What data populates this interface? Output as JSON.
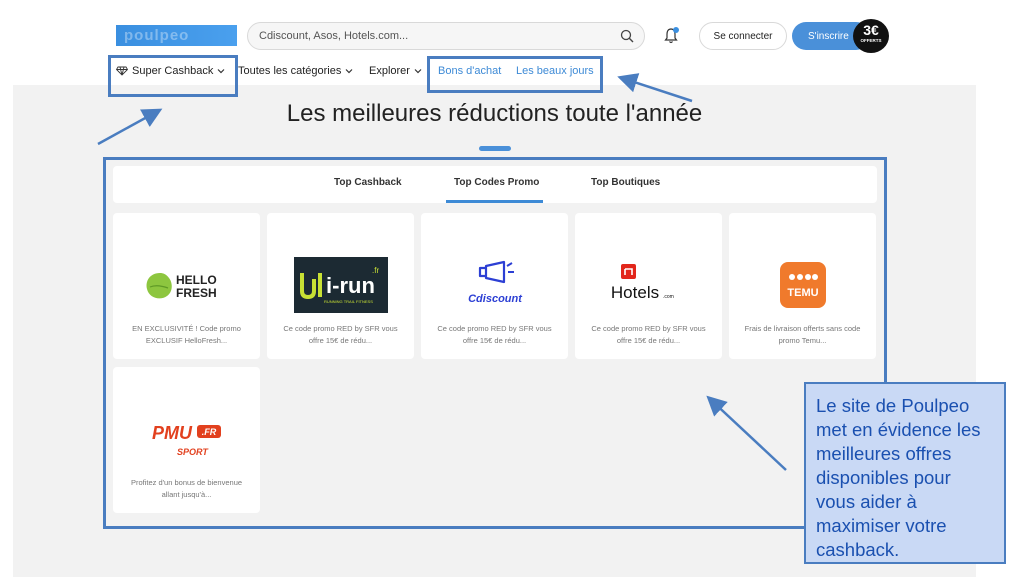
{
  "header": {
    "logo_text": "poulpeo",
    "search_placeholder": "Cdiscount, Asos, Hotels.com...",
    "login_label": "Se connecter",
    "signup_label": "S'inscrire",
    "bonus_amount": "3€",
    "bonus_label": "OFFERTS"
  },
  "nav": {
    "super_cashback": "Super Cashback",
    "categories": "Toutes les catégories",
    "explorer": "Explorer",
    "bons_achat": "Bons d'achat",
    "beaux_jours": "Les beaux jours"
  },
  "main": {
    "headline": "Les meilleures réductions toute l'année",
    "tabs": [
      {
        "label": "Top Cashback"
      },
      {
        "label": "Top Codes Promo"
      },
      {
        "label": "Top Boutiques"
      }
    ],
    "active_tab": "Top Codes Promo",
    "cards": [
      {
        "brand_line1": "HELLO",
        "brand_line2": "FRESH",
        "desc": "EN EXCLUSIVITÉ ! Code promo EXCLUSIF HelloFresh..."
      },
      {
        "brand": "i-run",
        "suffix": ".fr",
        "tagline": "RUNNING TRAIL FITNESS",
        "desc": "Ce code promo RED by SFR vous offre 15€ de rédu..."
      },
      {
        "brand": "Cdiscount",
        "desc": "Ce code promo RED by SFR vous offre 15€ de rédu..."
      },
      {
        "brand": "Hotels",
        "suffix": ".com",
        "desc": "Ce code promo RED by SFR vous offre 15€ de rédu..."
      },
      {
        "brand": "TEMU",
        "desc": "Frais de livraison offerts sans code promo Temu..."
      },
      {
        "brand": "PMU",
        "suffix": ".FR",
        "tagline": "SPORT",
        "desc": "Profitez d'un bonus de bienvenue allant jusqu'à..."
      }
    ]
  },
  "annotation": {
    "callout_text": "Le site de Poulpeo met en évidence les meilleures offres disponibles pour vous aider à maximiser votre cashback."
  },
  "colors": {
    "accent": "#3d8ad6",
    "annotation": "#4a7dc0",
    "callout_bg": "#c9d9f5",
    "temu": "#f07a2c",
    "pmu": "#e2401e",
    "cdiscount": "#2c3fd4",
    "hellofresh": "#8dc63f"
  }
}
